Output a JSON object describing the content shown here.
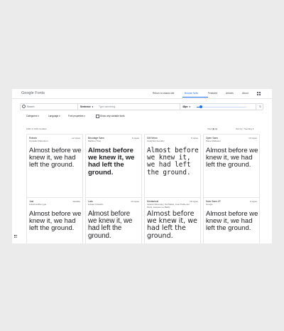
{
  "header": {
    "logo": "Google Fonts",
    "nav": [
      "Return to classic site",
      "Browse fonts",
      "Featured",
      "Articles",
      "About"
    ]
  },
  "search": {
    "placeholder": "Search",
    "mode": "Sentence",
    "type_placeholder": "Type something",
    "size": "48px"
  },
  "filters": {
    "categories": "Categories",
    "language": "Language",
    "font_properties": "Font properties",
    "variable_label": "Show only variable fonts"
  },
  "results": {
    "count": "1361 of 1361 families",
    "view_label": "View",
    "sort_label": "Sort by: Trending"
  },
  "sample_text": "Almost before we knew it, we had left the ground.",
  "cards": [
    {
      "name": "Roboto",
      "styles": "12 styles",
      "author": "Christian Robertson",
      "variant": ""
    },
    {
      "name": "Bricolage Sans",
      "styles": "6 styles",
      "author": "Mathieu Triay",
      "variant": "bold"
    },
    {
      "name": "DM Mono",
      "styles": "6 styles",
      "author": "Colophon Foundry",
      "variant": "mono"
    },
    {
      "name": "Open Sans",
      "styles": "10 styles",
      "author": "Steve Matteson",
      "variant": ""
    },
    {
      "name": "Jost",
      "styles": "Variable",
      "author": "indestructible type",
      "variant": ""
    },
    {
      "name": "Lato",
      "styles": "10 styles",
      "author": "Łukasz Dziedzic",
      "variant": "cond"
    },
    {
      "name": "Montserrat",
      "styles": "18 styles",
      "author": "Julieta Ulanovsky, Sol Matas, Juan Pablo del Peral, Jacques Le Bailly",
      "variant": "serif"
    },
    {
      "name": "Noto Sans JP",
      "styles": "6 styles",
      "author": "Google",
      "variant": ""
    }
  ],
  "colors": {
    "accent": "#1a73e8",
    "border": "#e6e6e6",
    "background": "#ebebeb"
  }
}
